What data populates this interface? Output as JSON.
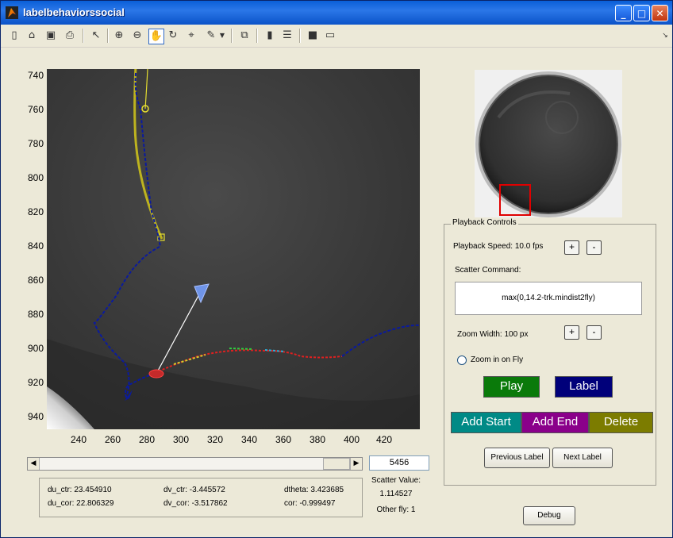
{
  "window": {
    "title": "labelbehaviorssocial"
  },
  "toolbar": {
    "icons": [
      "new-file-icon",
      "open-folder-icon",
      "save-icon",
      "print-icon",
      "pointer-icon",
      "zoom-in-icon",
      "zoom-out-icon",
      "pan-hand-icon",
      "rotate-icon",
      "data-cursor-icon",
      "brush-icon",
      "dropdown-arrow-icon",
      "link-plot-icon",
      "colorbar-icon",
      "legend-icon",
      "hide-plot-tools-icon",
      "show-plot-tools-icon"
    ]
  },
  "axes": {
    "y_ticks": [
      "740",
      "760",
      "780",
      "800",
      "820",
      "840",
      "860",
      "880",
      "900",
      "920",
      "940"
    ],
    "x_ticks": [
      "240",
      "260",
      "280",
      "300",
      "320",
      "340",
      "360",
      "380",
      "400",
      "420"
    ]
  },
  "frame": {
    "value": "5456"
  },
  "stats": {
    "du_ctr": "du_ctr: 23.454910",
    "du_cor": "du_cor: 22.806329",
    "dv_ctr": "dv_ctr: -3.445572",
    "dv_cor": "dv_cor: -3.517862",
    "dtheta": "dtheta: 3.423685",
    "cor": "cor: -0.999497"
  },
  "scatter": {
    "label": "Scatter Value:",
    "value": "1.114527",
    "other_fly": "Other fly: 1"
  },
  "playback": {
    "panel_title": "Playback Controls",
    "speed_label": "Playback Speed: 10.0 fps",
    "plus": "+",
    "minus": "-",
    "scatter_command_label": "Scatter Command:",
    "scatter_command": "max(0,14.2-trk.mindist2fly)",
    "zoom_width_label": "Zoom Width: 100 px",
    "zoom_on_fly": "Zoom in on Fly",
    "play": "Play",
    "label": "Label",
    "add_start": "Add Start",
    "add_end": "Add End",
    "delete": "Delete",
    "previous_label": "Previous Label",
    "next_label": "Next Label",
    "debug": "Debug"
  },
  "colors": {
    "play": "#0a7a0a",
    "label": "#00007a",
    "add_start": "#008a86",
    "add_end": "#8a008a",
    "delete": "#7c7c00",
    "trajectory": "#0a1a9e",
    "other_track": "#d4cc2c"
  }
}
